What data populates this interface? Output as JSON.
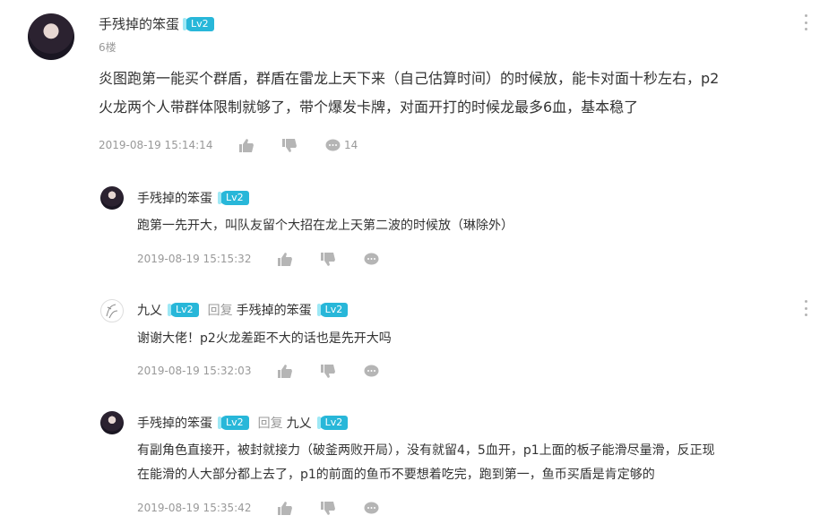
{
  "main_comment": {
    "username": "手残掉的笨蛋",
    "level": "Lv2",
    "floor": "6楼",
    "content_line1": "炎图跑第一能买个群盾，群盾在雷龙上天下来（自己估算时间）的时候放，能卡对面十秒左右，p2",
    "content_line2": "火龙两个人带群体限制就够了，带个爆发卡牌，对面开打的时候龙最多6血，基本稳了",
    "time": "2019-08-19 15:14:14",
    "comment_count": "14"
  },
  "replies": [
    {
      "username": "手残掉的笨蛋",
      "level": "Lv2",
      "content": "跑第一先开大，叫队友留个大招在龙上天第二波的时候放（琳除外）",
      "time": "2019-08-19 15:15:32"
    },
    {
      "username": "九乂",
      "level": "Lv2",
      "reply_word": "回复",
      "reply_to": "手残掉的笨蛋",
      "reply_to_level": "Lv2",
      "content": "谢谢大佬！p2火龙差距不大的话也是先开大吗",
      "time": "2019-08-19 15:32:03"
    },
    {
      "username": "手残掉的笨蛋",
      "level": "Lv2",
      "reply_word": "回复",
      "reply_to": "九乂",
      "reply_to_level": "Lv2",
      "content_line1": "有副角色直接开，被封就接力（破釜两败开局），没有就留4，5血开，p1上面的板子能滑尽量滑，反正现",
      "content_line2": "在能滑的人大部分都上去了，p1的前面的鱼币不要想着吃完，跑到第一，鱼币买盾是肯定够的",
      "time": "2019-08-19 15:35:42"
    }
  ],
  "colors": {
    "level_badge": "#28b7d9",
    "muted": "#999999",
    "icon": "#b5b5b5"
  },
  "icons": [
    "like-icon",
    "dislike-icon",
    "comment-icon",
    "more-options-icon"
  ]
}
